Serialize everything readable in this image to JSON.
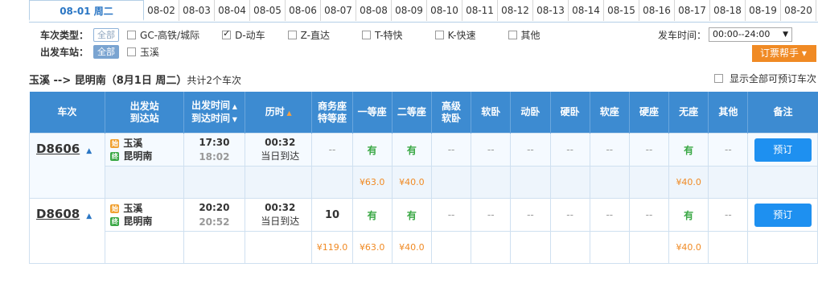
{
  "dates": {
    "active_date": "08-01",
    "active_weekday": "周二",
    "others": [
      "08-02",
      "08-03",
      "08-04",
      "08-05",
      "08-06",
      "08-07",
      "08-08",
      "08-09",
      "08-10",
      "08-11",
      "08-12",
      "08-13",
      "08-14",
      "08-15",
      "08-16",
      "08-17",
      "08-18",
      "08-19",
      "08-20"
    ]
  },
  "filters": {
    "train_type_label": "车次类型：",
    "all_label": "全部",
    "types": [
      {
        "label": "GC-高铁/城际",
        "checked": false
      },
      {
        "label": "D-动车",
        "checked": true
      },
      {
        "label": "Z-直达",
        "checked": false
      },
      {
        "label": "T-特快",
        "checked": false
      },
      {
        "label": "K-快速",
        "checked": false
      },
      {
        "label": "其他",
        "checked": false
      }
    ],
    "depart_station_label": "出发车站：",
    "station_all_label": "全部",
    "station": "玉溪",
    "depart_time_label": "发车时间：",
    "depart_time_value": "00:00--24:00",
    "help_button": "订票帮手 ▾"
  },
  "route": {
    "title": "玉溪 --> 昆明南（8月1日  周二）",
    "count_text": "共计2个车次",
    "show_all_label": "显示全部可预订车次"
  },
  "table": {
    "headers": {
      "train": "车次",
      "station_1": "出发站",
      "station_2": "到达站",
      "time_1": "出发时间",
      "time_2": "到达时间",
      "duration": "历时",
      "business_1": "商务座",
      "business_2": "特等座",
      "first": "一等座",
      "second": "二等座",
      "premium_1": "高级",
      "premium_2": "软卧",
      "soft_sleeper": "软卧",
      "emu_sleeper": "动卧",
      "hard_sleeper": "硬卧",
      "soft_seat": "软座",
      "hard_seat": "硬座",
      "no_seat": "无座",
      "other": "其他",
      "remark": "备注"
    },
    "rows": [
      {
        "train_no": "D8606",
        "from": "玉溪",
        "to": "昆明南",
        "start_badge": "始",
        "end_badge": "终",
        "depart": "17:30",
        "arrive": "18:02",
        "duration": "00:32",
        "arrive_day": "当日到达",
        "seats": [
          "--",
          "有",
          "有",
          "--",
          "--",
          "--",
          "--",
          "--",
          "--",
          "有",
          "--"
        ],
        "prices": [
          "",
          "¥63.0",
          "¥40.0",
          "",
          "",
          "",
          "",
          "",
          "",
          "¥40.0",
          ""
        ],
        "book": "预订"
      },
      {
        "train_no": "D8608",
        "from": "玉溪",
        "to": "昆明南",
        "start_badge": "始",
        "end_badge": "终",
        "depart": "20:20",
        "arrive": "20:52",
        "duration": "00:32",
        "arrive_day": "当日到达",
        "seats": [
          "10",
          "有",
          "有",
          "--",
          "--",
          "--",
          "--",
          "--",
          "--",
          "有",
          "--"
        ],
        "prices": [
          "¥119.0",
          "¥63.0",
          "¥40.0",
          "",
          "",
          "",
          "",
          "",
          "",
          "¥40.0",
          ""
        ],
        "book": "预订"
      }
    ]
  }
}
